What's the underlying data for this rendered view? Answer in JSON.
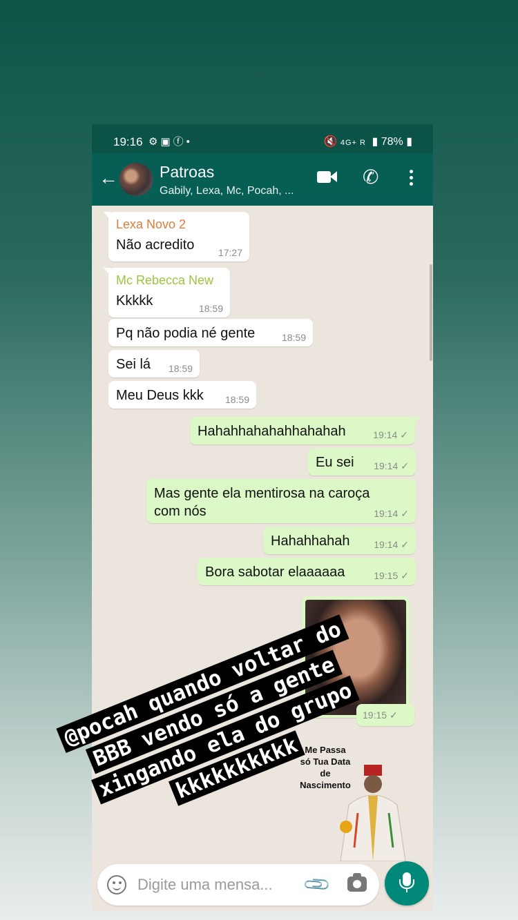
{
  "status_bar": {
    "time": "19:16",
    "battery": "78%",
    "network": "4G+ R"
  },
  "header": {
    "title": "Patroas",
    "subtitle": "Gabily, Lexa, Mc, Pocah, ..."
  },
  "messages": [
    {
      "direction": "in",
      "sender": "Lexa Novo 2",
      "sender_color": "#e07b39",
      "text": "Não acredito",
      "time": "17:27"
    },
    {
      "direction": "in",
      "sender": "Mc Rebecca New",
      "sender_color": "#9bc53d",
      "text": "Kkkkk",
      "time": "18:59"
    },
    {
      "direction": "in",
      "text": "Pq não podia né gente",
      "time": "18:59"
    },
    {
      "direction": "in",
      "text": "Sei lá",
      "time": "18:59"
    },
    {
      "direction": "in",
      "text": "Meu Deus kkk",
      "time": "18:59"
    },
    {
      "direction": "out",
      "text": "Hahahhahahahhahahah",
      "time": "19:14",
      "tick": "✓"
    },
    {
      "direction": "out",
      "text": "Eu sei",
      "time": "19:14",
      "tick": "✓"
    },
    {
      "direction": "out",
      "text": "Mas gente ela mentirosa na caroça com nós",
      "time": "19:14",
      "tick": "✓"
    },
    {
      "direction": "out",
      "text": "Hahahhahah",
      "time": "19:14",
      "tick": "✓"
    },
    {
      "direction": "out",
      "text": "Bora sabotar elaaaaaa",
      "time": "19:15",
      "tick": "✓"
    },
    {
      "direction": "out",
      "type": "image",
      "time": "19:15",
      "tick": "✓"
    }
  ],
  "sticker": {
    "text_lines": [
      "Me Passa",
      "só Tua Data",
      "de",
      "Nascimento"
    ]
  },
  "input": {
    "placeholder": "Digite uma mensa..."
  },
  "overlay_text": {
    "lines": [
      "@pocah quando voltar do",
      "BBB vendo só a gente",
      "xingando ela do grupo",
      "kkkkkkkkkk"
    ]
  },
  "colors": {
    "header": "#075e54",
    "outgoing_bubble": "#dcf8c6",
    "incoming_bubble": "#ffffff",
    "mic_button": "#00897b"
  }
}
